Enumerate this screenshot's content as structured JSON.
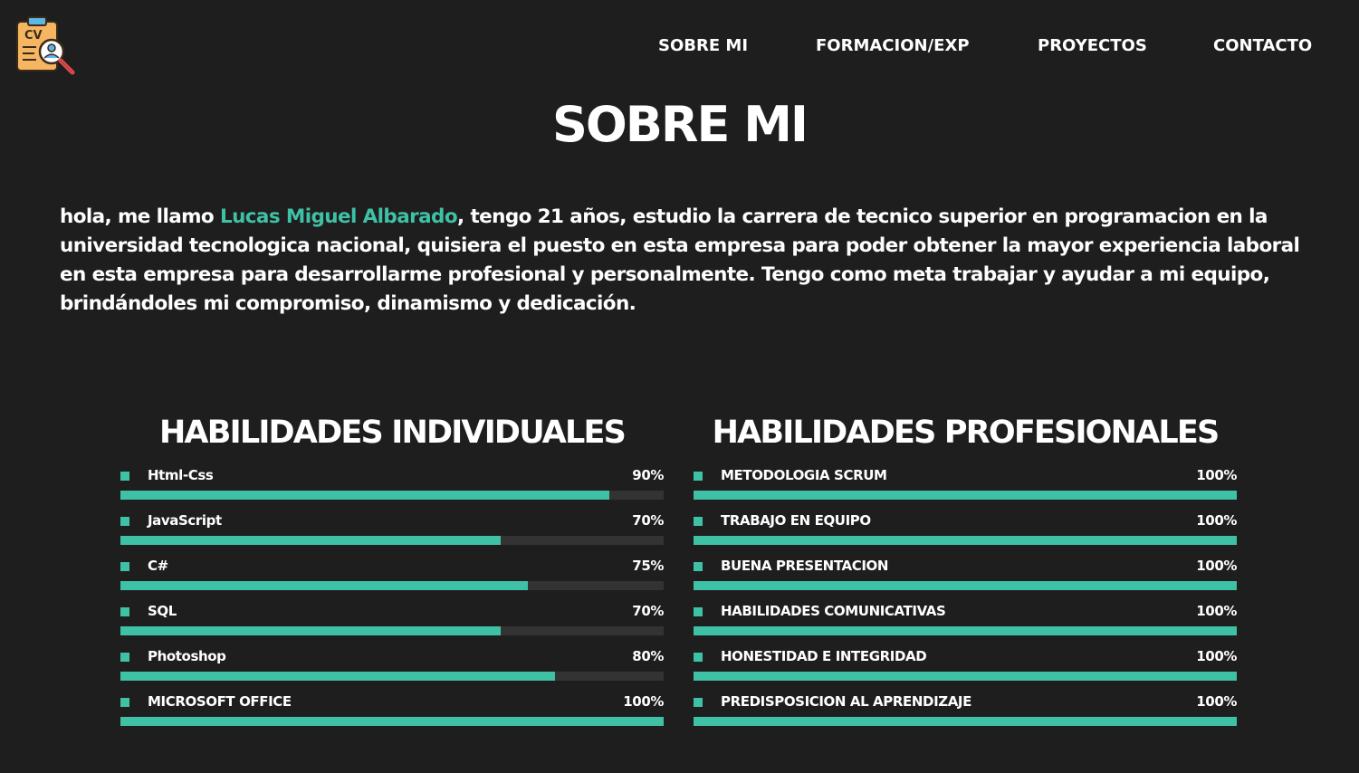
{
  "colors": {
    "background": "#1e1e1e",
    "accent": "#3fc1a5",
    "track": "#333333",
    "text": "#ffffff"
  },
  "logo": {
    "icon": "cv-clipboard-search-icon",
    "text": "CV"
  },
  "nav": {
    "items": [
      {
        "label": "SOBRE MI"
      },
      {
        "label": "FORMACION/EXP"
      },
      {
        "label": "PROYECTOS"
      },
      {
        "label": "CONTACTO"
      }
    ]
  },
  "page_title": "SOBRE MI",
  "about": {
    "before_name": "hola, me llamo ",
    "name": "Lucas Miguel Albarado",
    "after_name": ", tengo 21 años, estudio la carrera de tecnico superior en programacion en la universidad tecnologica nacional, quisiera el puesto en esta empresa para poder obtener la mayor experiencia laboral en esta empresa para desarrollarme profesional y personalmente. Tengo como meta trabajar y ayudar a mi equipo, brindándoles mi compromiso, dinamismo y dedicación."
  },
  "individual_skills": {
    "title": "HABILIDADES INDIVIDUALES",
    "items": [
      {
        "label": "Html-Css",
        "percent_text": "90%",
        "level": 0.9
      },
      {
        "label": "JavaScript",
        "percent_text": "70%",
        "level": 0.7
      },
      {
        "label": "C#",
        "percent_text": "75%",
        "level": 0.75
      },
      {
        "label": "SQL",
        "percent_text": "70%",
        "level": 0.7
      },
      {
        "label": "Photoshop",
        "percent_text": "80%",
        "level": 0.8
      },
      {
        "label": "MICROSOFT OFFICE",
        "percent_text": "100%",
        "level": 1.0
      }
    ]
  },
  "professional_skills": {
    "title": "HABILIDADES PROFESIONALES",
    "items": [
      {
        "label": "METODOLOGIA SCRUM",
        "percent_text": "100%",
        "level": 1.0
      },
      {
        "label": "TRABAJO EN EQUIPO",
        "percent_text": "100%",
        "level": 1.0
      },
      {
        "label": "BUENA PRESENTACION",
        "percent_text": "100%",
        "level": 1.0
      },
      {
        "label": "HABILIDADES COMUNICATIVAS",
        "percent_text": "100%",
        "level": 1.0
      },
      {
        "label": "HONESTIDAD E INTEGRIDAD",
        "percent_text": "100%",
        "level": 1.0
      },
      {
        "label": "PREDISPOSICION AL APRENDIZAJE",
        "percent_text": "100%",
        "level": 1.0
      }
    ]
  }
}
